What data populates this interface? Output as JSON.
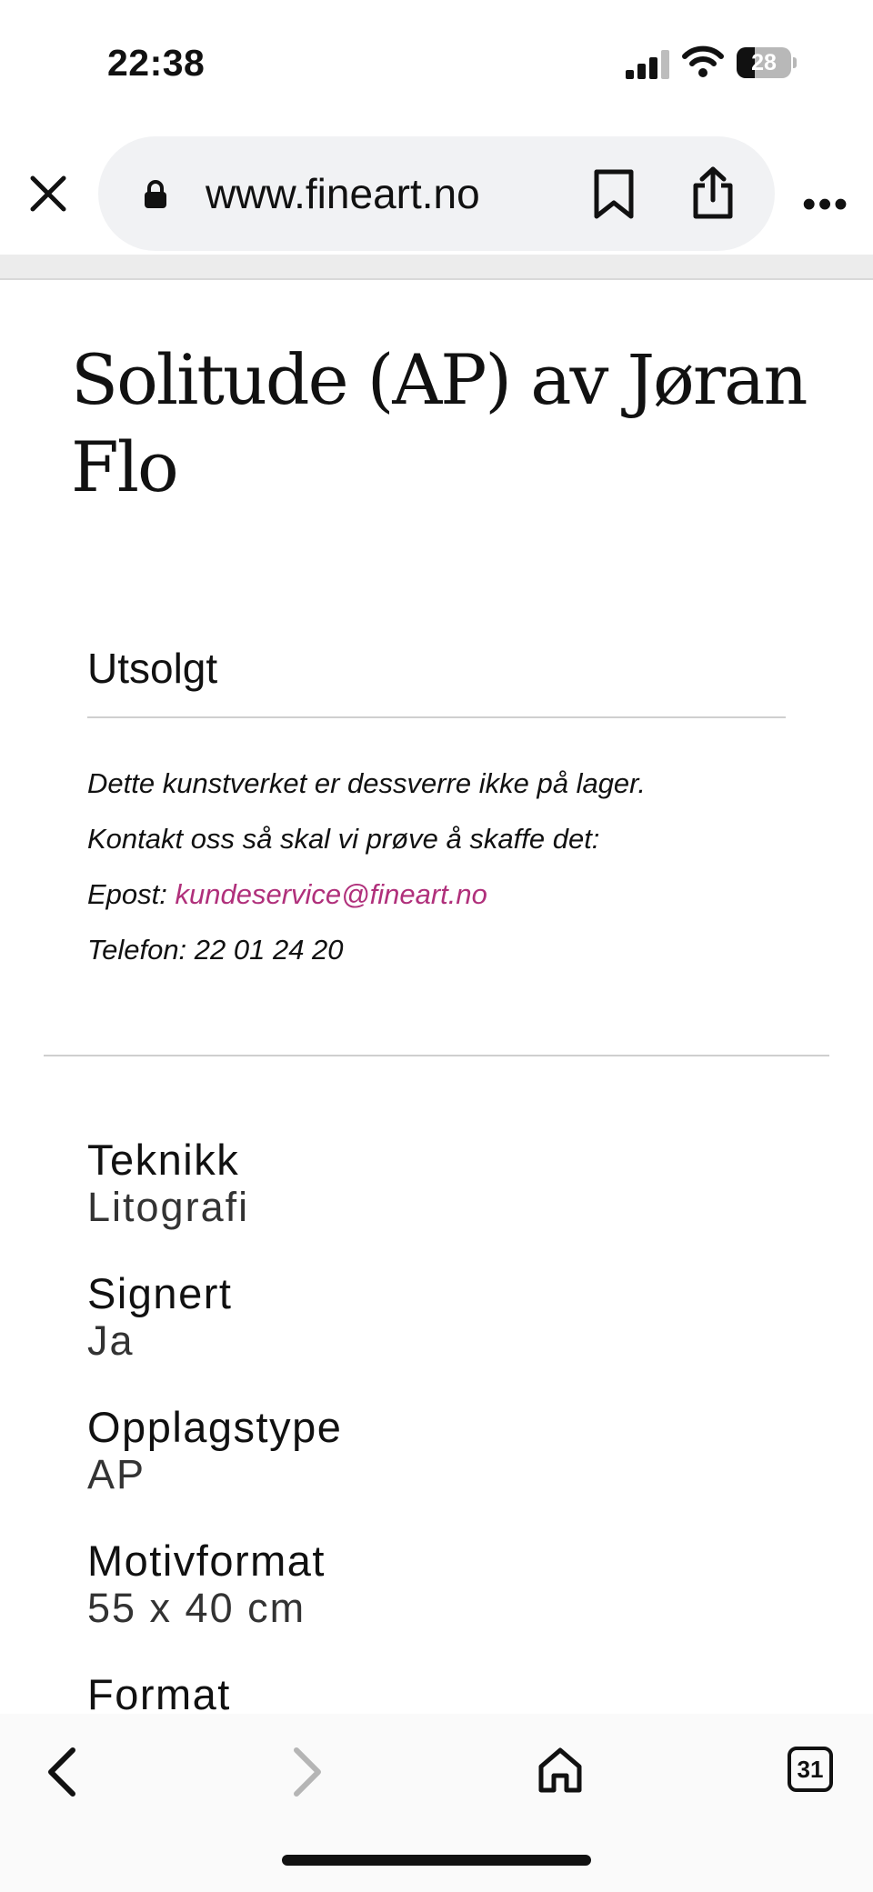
{
  "status_bar": {
    "time": "22:38",
    "battery_level": "28",
    "icons": [
      "signal-icon",
      "wifi-icon",
      "battery-icon"
    ]
  },
  "browser": {
    "url": "www.fineart.no",
    "icons": [
      "close-icon",
      "lock-icon",
      "bookmark-icon",
      "share-icon",
      "more-icon"
    ],
    "more_label": "•••"
  },
  "product": {
    "title": "Solitude (AP) av Jøran Flo"
  },
  "stock": {
    "heading": "Utsolgt",
    "line1": "Dette kunstverket er dessverre ikke på lager.",
    "line2": "Kontakt oss så skal vi prøve å skaffe det:",
    "email_label": "Epost: ",
    "email": "kundeservice@fineart.no",
    "phone": "Telefon: 22 01 24 20"
  },
  "specs": [
    {
      "label": "Teknikk",
      "value": "Litografi"
    },
    {
      "label": "Signert",
      "value": "Ja"
    },
    {
      "label": "Opplagstype",
      "value": "AP"
    },
    {
      "label": "Motivformat",
      "value": "55 x 40 cm"
    },
    {
      "label": "Format",
      "value": ""
    }
  ],
  "bottom_bar": {
    "tab_count": "31",
    "icons": [
      "back-icon",
      "forward-icon",
      "home-icon",
      "tabs-icon"
    ]
  },
  "colors": {
    "link": "#b0307b",
    "disabled": "#b5b5b5"
  }
}
